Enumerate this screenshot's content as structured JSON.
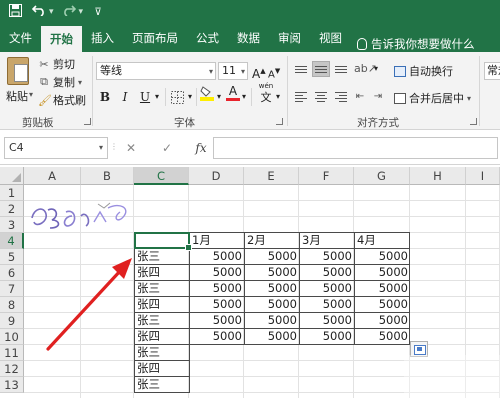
{
  "quick_access": {
    "save_icon": "save-icon",
    "undo_icon": "undo-icon",
    "redo_icon": "redo-icon"
  },
  "tabs": [
    {
      "label": "文件"
    },
    {
      "label": "开始",
      "active": true
    },
    {
      "label": "插入"
    },
    {
      "label": "页面布局"
    },
    {
      "label": "公式"
    },
    {
      "label": "数据"
    },
    {
      "label": "审阅"
    },
    {
      "label": "视图"
    }
  ],
  "tell_me": "告诉我你想要做什么",
  "clipboard": {
    "paste": "粘贴",
    "cut": "剪切",
    "copy": "复制",
    "format_painter": "格式刷",
    "group_label": "剪贴板"
  },
  "font": {
    "name": "等线",
    "size": "11",
    "bold": "B",
    "italic": "I",
    "underline": "U",
    "grow": "A",
    "shrink": "A",
    "font_color_letter": "A",
    "wen": "wén",
    "wen_char": "文",
    "group_label": "字体"
  },
  "alignment": {
    "wrap_text": "自动换行",
    "merge_center": "合并后居中",
    "group_label": "对齐方式"
  },
  "number": {
    "format": "常规"
  },
  "formula_bar": {
    "name_box": "C4",
    "cancel": "✕",
    "enter": "✓",
    "fx": "fx",
    "value": ""
  },
  "grid": {
    "columns": [
      "A",
      "B",
      "C",
      "D",
      "E",
      "F",
      "G",
      "H",
      "I"
    ],
    "rows": [
      "1",
      "2",
      "3",
      "4",
      "5",
      "6",
      "7",
      "8",
      "9",
      "10",
      "11",
      "12",
      "13"
    ],
    "selected_column": "C",
    "selected_row": "4",
    "header_row": [
      "",
      "1月",
      "2月",
      "3月",
      "4月"
    ],
    "data_rows": [
      [
        "张三",
        "5000",
        "5000",
        "5000",
        "5000"
      ],
      [
        "张四",
        "5000",
        "5000",
        "5000",
        "5000"
      ],
      [
        "张三",
        "5000",
        "5000",
        "5000",
        "5000"
      ],
      [
        "张四",
        "5000",
        "5000",
        "5000",
        "5000"
      ],
      [
        "张三",
        "5000",
        "5000",
        "5000",
        "5000"
      ],
      [
        "张四",
        "5000",
        "5000",
        "5000",
        "5000"
      ],
      [
        "张三",
        "",
        "",
        "",
        ""
      ],
      [
        "张四",
        "",
        "",
        "",
        ""
      ],
      [
        "张三",
        "",
        "",
        "",
        ""
      ]
    ]
  },
  "colors": {
    "excel_green": "#217346",
    "annotation_arrow": "#e02020",
    "font_color_bar": "#e8232c",
    "highlight_bar": "#ffee00"
  }
}
